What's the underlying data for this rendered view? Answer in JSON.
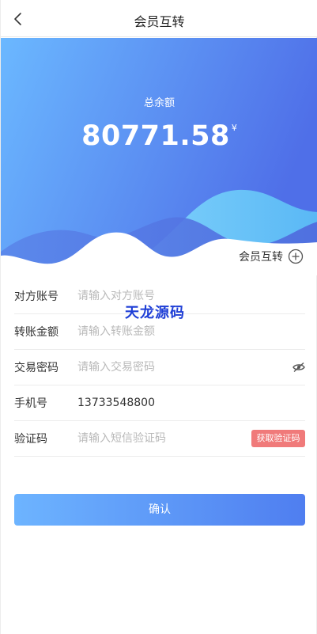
{
  "header": {
    "title": "会员互转",
    "back_icon": "chevron-left-icon"
  },
  "balance": {
    "label": "总余额",
    "value": "80771.58",
    "currency": "¥"
  },
  "transfer_link": {
    "label": "会员互转",
    "icon": "plus-circle-icon"
  },
  "form": {
    "rows": [
      {
        "label": "对方账号",
        "placeholder": "请输入对方账号"
      },
      {
        "label": "转账金额",
        "placeholder": "请输入转账金额"
      },
      {
        "label": "交易密码",
        "placeholder": "请输入交易密码"
      },
      {
        "label": "手机号",
        "value": "13733548800"
      },
      {
        "label": "验证码",
        "placeholder": "请输入短信验证码"
      }
    ],
    "get_code_label": "获取验证码"
  },
  "watermark": "天龙源码",
  "confirm_label": "确认",
  "colors": {
    "gradient_start": "#6bb8ff",
    "gradient_end": "#4f6fe8",
    "wave_light": "#6ec8f8",
    "code_button": "#f07a7a"
  }
}
